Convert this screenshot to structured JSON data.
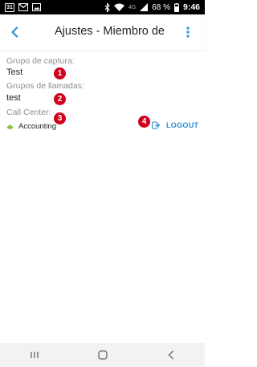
{
  "status_bar": {
    "calendar_day": "31",
    "network": "4G",
    "battery": "68 %",
    "time": "9:46",
    "icons": [
      "calendar-icon",
      "gmail-icon",
      "image-icon",
      "bluetooth-icon",
      "wifi-icon",
      "signal-icon",
      "battery-icon"
    ]
  },
  "app_bar": {
    "title": "Ajustes - Miembro de",
    "accent_color": "#2b8fd6"
  },
  "fields": [
    {
      "label": "Grupo de captura:",
      "value": "Test",
      "marker": "1"
    },
    {
      "label": "Grupos de llamadas:",
      "value": "test",
      "marker": "2"
    },
    {
      "label": "Call Center:",
      "marker": "3"
    }
  ],
  "call_center": {
    "name": "Accounting",
    "status_color": "#8bc34a",
    "logout_label": "LOGOUT",
    "logout_marker": "4"
  },
  "marker_color": "#d0021b",
  "nav_bar": {
    "icons": [
      "recents-icon",
      "home-icon",
      "back-icon"
    ]
  }
}
